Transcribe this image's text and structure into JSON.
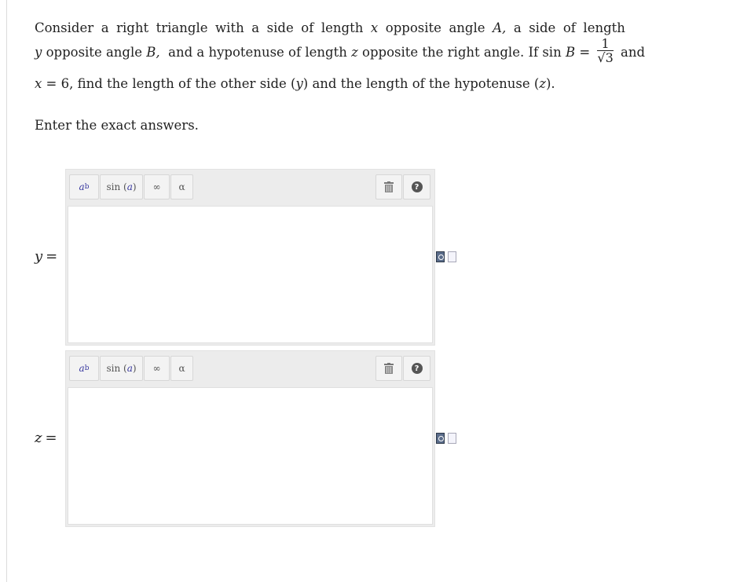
{
  "problem": {
    "line1_words": [
      "Consider",
      "a",
      "right",
      "triangle",
      "with",
      "a",
      "side",
      "of",
      "length",
      "x",
      "opposite",
      "angle",
      "A,",
      "a",
      "side",
      "of",
      "length"
    ],
    "line2": {
      "var_y": "y",
      "t1": " opposite angle ",
      "var_B": "B,",
      "t2": "  and a hypotenuse of length ",
      "var_z": "z",
      "t3": " opposite the right angle. If sin ",
      "var_B2": "B",
      "t4": " = ",
      "frac_num": "1",
      "frac_den": "√3",
      "t5": " and"
    },
    "line3": {
      "var_x": "x",
      "t1": " = 6, find the length of the other side (",
      "var_y": "y",
      "t2": ") and the length of the hypotenuse (",
      "var_z": "z",
      "t3": ")."
    }
  },
  "instructions": "Enter the exact answers.",
  "answers": [
    {
      "var": "y",
      "eq": "=",
      "toolbar": {
        "power": "a",
        "power_sup": "b",
        "func_prefix": "sin (",
        "func_arg": "a",
        "func_suffix": ")",
        "infinity": "∞",
        "greek": "α",
        "trash": "🗑",
        "help": "?"
      },
      "value": ""
    },
    {
      "var": "z",
      "eq": "=",
      "toolbar": {
        "power": "a",
        "power_sup": "b",
        "func_prefix": "sin (",
        "func_arg": "a",
        "func_suffix": ")",
        "infinity": "∞",
        "greek": "α",
        "trash": "🗑",
        "help": "?"
      },
      "value": ""
    }
  ],
  "icons": {
    "trash": "trash-icon",
    "help": "help-icon",
    "preview": "preview-icon",
    "file": "file-icon"
  }
}
